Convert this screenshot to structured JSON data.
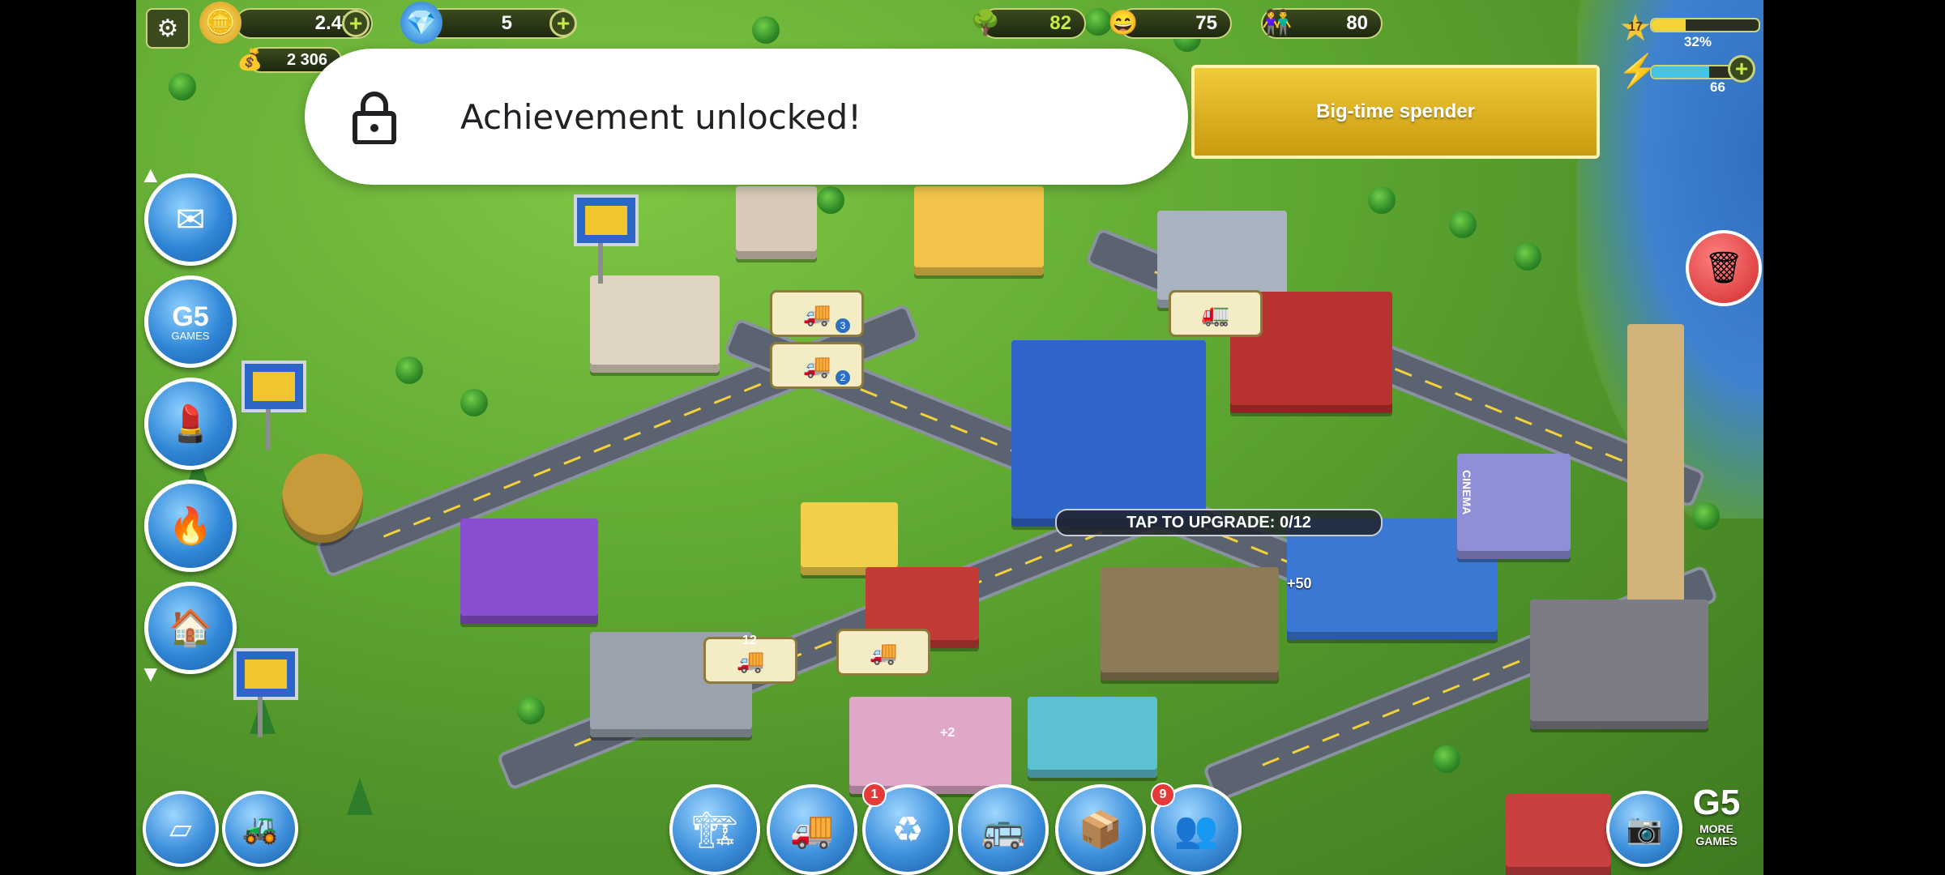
{
  "hud": {
    "coins": "2.4M",
    "gems": "5",
    "income": "2 306",
    "eco": "82",
    "happiness": "75",
    "population": "80",
    "level": "17",
    "xp_percent": "32%",
    "energy": "66"
  },
  "notification": {
    "text": "Achievement unlocked!"
  },
  "achievement_banner": {
    "title": "Big-time spender"
  },
  "city": {
    "upgrade_label": "TAP TO UPGRADE: 0/12",
    "truck_tags": [
      "3",
      "2"
    ],
    "bonus_label": "+50",
    "plus_label": "+2",
    "count_label": "12",
    "cinema_sign": "CINEMA"
  },
  "side_menu": {
    "g5_label": "G5",
    "games_label": "GAMES"
  },
  "bottom_bar": {
    "recycle_badge": "1",
    "social_badge": "9",
    "more_games_brand": "G5",
    "more_games_label": "MORE GAMES"
  },
  "colors": {
    "accent_gold": "#f0cb3a",
    "hud_green": "#c9e84a",
    "button_blue": "#2f86d6"
  }
}
